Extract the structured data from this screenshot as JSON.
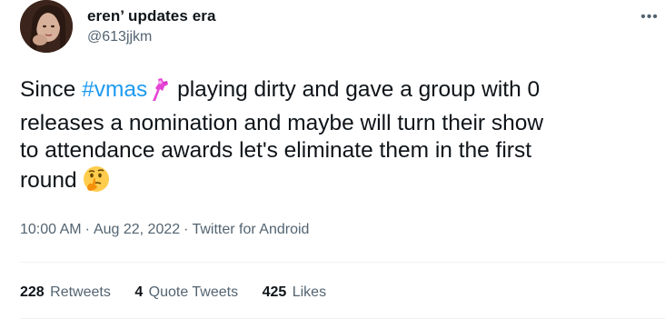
{
  "user": {
    "display_name": "eren’ updates era",
    "handle": "@613jjkm",
    "avatar_icon": "profile-photo"
  },
  "menu": {
    "more_label": "•••"
  },
  "tweet": {
    "text_before_hashtag": "Since ",
    "hashtag": "#vmas",
    "line1_after": " playing dirty and gave a group with 0",
    "line2": "releases a nomination and maybe will turn their show",
    "line3": "to attendance awards let's eliminate them in the first",
    "line4": "round",
    "hashtag_emoji_icon": "vmas-moonperson-icon",
    "end_emoji_icon": "thinking-face-icon"
  },
  "meta": {
    "time": "10:00 AM",
    "separator": "·",
    "date": "Aug 22, 2022",
    "source": "Twitter for Android"
  },
  "stats": {
    "retweets_count": "228",
    "retweets_label": "Retweets",
    "quotes_count": "4",
    "quotes_label": "Quote Tweets",
    "likes_count": "425",
    "likes_label": "Likes"
  },
  "colors": {
    "link": "#1d9bf0",
    "secondary_text": "#536471",
    "primary_text": "#0f1419",
    "divider": "#eff3f4"
  }
}
